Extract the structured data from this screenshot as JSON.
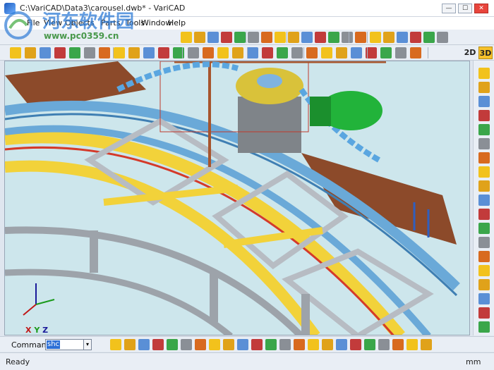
{
  "window": {
    "title": "C:\\VariCAD\\Data3\\carousel.dwb* - VariCAD",
    "minimize": "—",
    "maximize": "☐",
    "close": "✕"
  },
  "menu": [
    {
      "label": "File",
      "name": "file"
    },
    {
      "label": "View",
      "name": "view"
    },
    {
      "label": "Objects",
      "name": "objects"
    },
    {
      "label": "Parts",
      "name": "parts"
    },
    {
      "label": "Tools",
      "name": "tools"
    },
    {
      "label": "Window",
      "name": "window"
    },
    {
      "label": "Help",
      "name": "help"
    }
  ],
  "watermark": {
    "text": "河东软件园",
    "url": "www.pc0359.cn"
  },
  "view_toggle": {
    "two_d": "2D",
    "three_d": "3D"
  },
  "axes": {
    "x": "X",
    "y": "Y",
    "z": "Z"
  },
  "command": {
    "label": "Command:",
    "value": "shc",
    "dropdown": "▾"
  },
  "status": {
    "text": "Ready",
    "units": "mm"
  },
  "colors": {
    "toolbar_bg": "#e9eef5",
    "viewport_bg": "#cde6ec",
    "accent_yellow": "#f7c22b",
    "frame_yellow": "#f2d23a",
    "track_blue": "#6aa9d8",
    "motor_green": "#22b33a"
  }
}
